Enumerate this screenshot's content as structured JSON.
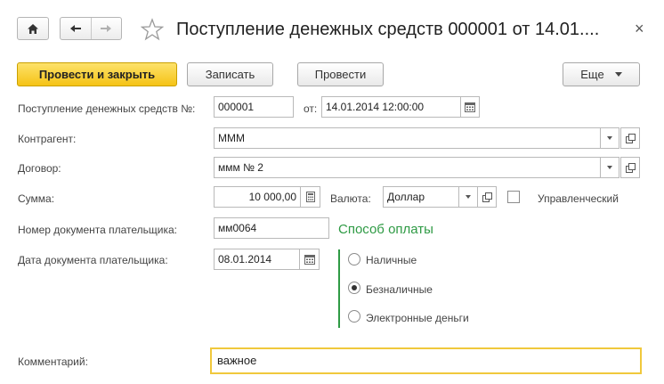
{
  "window": {
    "title": "Поступление денежных средств 000001 от 14.01....",
    "close": "×"
  },
  "toolbar": {
    "post_and_close": "Провести и закрыть",
    "save": "Записать",
    "post": "Провести",
    "more": "Еще"
  },
  "form": {
    "doc_number_label": "Поступление денежных средств №:",
    "doc_number": "000001",
    "date_label": "от:",
    "date": "14.01.2014 12:00:00",
    "counterparty_label": "Контрагент:",
    "counterparty": "МММ",
    "contract_label": "Договор:",
    "contract": "ммм № 2",
    "amount_label": "Сумма:",
    "amount": "10 000,00",
    "currency_label": "Валюта:",
    "currency": "Доллар",
    "managerial_label": "Управленческий",
    "managerial_checked": false,
    "payer_doc_number_label": "Номер документа плательщика:",
    "payer_doc_number": "мм0064",
    "payer_doc_date_label": "Дата документа плательщика:",
    "payer_doc_date": "08.01.2014",
    "payment_method_title": "Способ оплаты",
    "payment_methods": [
      {
        "label": "Наличные",
        "selected": false
      },
      {
        "label": "Безналичные",
        "selected": true
      },
      {
        "label": "Электронные деньги",
        "selected": false
      }
    ],
    "comment_label": "Комментарий:",
    "comment": "важное"
  },
  "colors": {
    "primary_button": "#f5c316",
    "section_accent": "#2e9a44",
    "comment_border": "#f0c83c"
  }
}
